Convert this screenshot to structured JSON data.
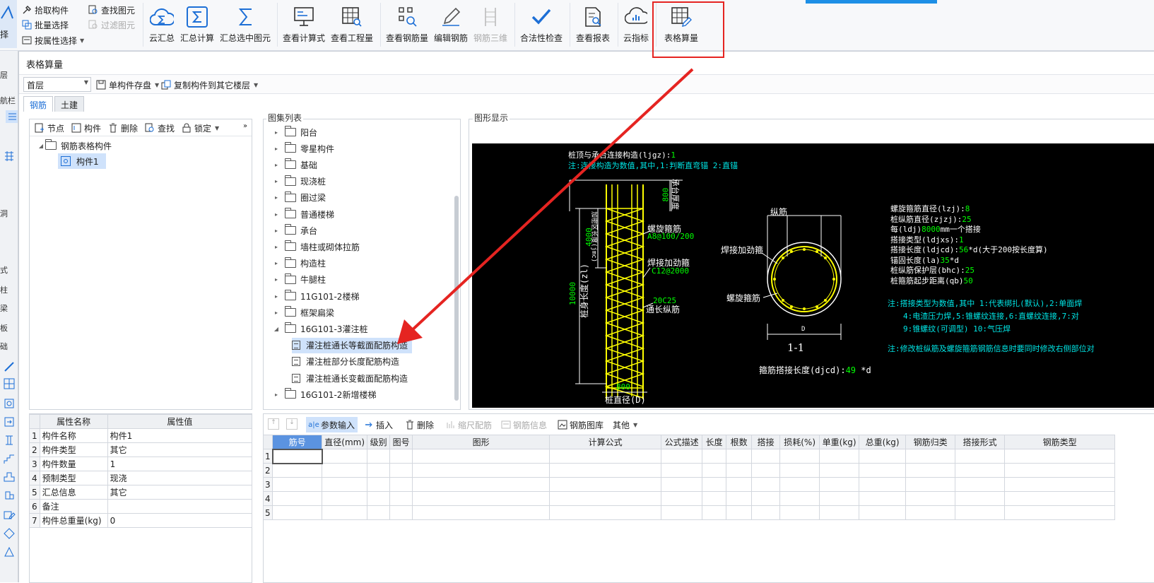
{
  "ribbon": {
    "left_partial": "选择",
    "small_col1": [
      "拾取构件",
      "批量选择",
      "按属性选择"
    ],
    "small_col2": [
      "查找图元",
      "过滤图元"
    ],
    "buttons": [
      {
        "label": "云汇总",
        "icon": "cloud-sigma-icon"
      },
      {
        "label": "汇总计算",
        "icon": "sigma-icon"
      },
      {
        "label": "汇总选中图元",
        "icon": "sigma-select-icon"
      },
      {
        "label": "查看计算式",
        "icon": "formula-view-icon"
      },
      {
        "label": "查看工程量",
        "icon": "quantity-view-icon"
      },
      {
        "label": "查看钢筋量",
        "icon": "rebar-view-icon"
      },
      {
        "label": "编辑钢筋",
        "icon": "pencil-icon"
      },
      {
        "label": "钢筋三维",
        "icon": "rebar-3d-icon",
        "disabled": true
      },
      {
        "label": "合法性检查",
        "icon": "check-icon"
      },
      {
        "label": "查看报表",
        "icon": "report-icon"
      },
      {
        "label": "云指标",
        "icon": "cloud-chart-icon"
      },
      {
        "label": "表格算量",
        "icon": "table-edit-icon"
      }
    ],
    "highlight_color": "#e52421",
    "accent_color": "#1d6fd6"
  },
  "leftstrip": [
    "层",
    "航栏",
    "",
    "洞",
    "式",
    "柱",
    "梁",
    "板",
    "础"
  ],
  "dialog": {
    "title": "表格算量",
    "floor_combo": "首层",
    "toolbar": [
      "单构件存盘",
      "复制构件到其它楼层"
    ],
    "tabs": [
      "钢筋",
      "土建"
    ],
    "tree_toolbar": [
      "节点",
      "构件",
      "删除",
      "查找",
      "锁定"
    ],
    "tree": {
      "root": "钢筋表格构件",
      "child": "构件1"
    },
    "atlas_label": "图集列表",
    "atlas": [
      {
        "label": "阳台",
        "type": "folder"
      },
      {
        "label": "零星构件",
        "type": "folder"
      },
      {
        "label": "基础",
        "type": "folder"
      },
      {
        "label": "现浇桩",
        "type": "folder"
      },
      {
        "label": "圈过梁",
        "type": "folder"
      },
      {
        "label": "普通楼梯",
        "type": "folder"
      },
      {
        "label": "承台",
        "type": "folder"
      },
      {
        "label": "墙柱或砌体拉筋",
        "type": "folder"
      },
      {
        "label": "构造柱",
        "type": "folder"
      },
      {
        "label": "牛腿柱",
        "type": "folder"
      },
      {
        "label": "11G101-2楼梯",
        "type": "folder"
      },
      {
        "label": "框架扁梁",
        "type": "folder"
      },
      {
        "label": "16G101-3灌注桩",
        "type": "folder-open"
      },
      {
        "label": "灌注桩通长等截面配筋构造",
        "type": "doc",
        "selected": true
      },
      {
        "label": "灌注桩部分长度配筋构造",
        "type": "doc"
      },
      {
        "label": "灌注桩通长变截面配筋构造",
        "type": "doc"
      },
      {
        "label": "16G101-2新增楼梯",
        "type": "folder"
      }
    ],
    "figure_label": "图形显示",
    "props": {
      "headers": [
        "属性名称",
        "属性值"
      ],
      "rows": [
        [
          "1",
          "构件名称",
          "构件1"
        ],
        [
          "2",
          "构件类型",
          "其它"
        ],
        [
          "3",
          "构件数量",
          "1"
        ],
        [
          "4",
          "预制类型",
          "现浇"
        ],
        [
          "5",
          "汇总信息",
          "其它"
        ],
        [
          "6",
          "备注",
          ""
        ],
        [
          "7",
          "构件总重量(kg)",
          "0"
        ]
      ]
    },
    "grid_toolbar": [
      {
        "label": "参数输入",
        "active": true
      },
      {
        "label": "插入"
      },
      {
        "label": "删除"
      },
      {
        "label": "缩尺配筋",
        "disabled": true
      },
      {
        "label": "钢筋信息",
        "disabled": true
      },
      {
        "label": "钢筋图库"
      },
      {
        "label": "其他"
      }
    ],
    "grid": {
      "headers": [
        "筋号",
        "直径(mm)",
        "级别",
        "图号",
        "图形",
        "计算公式",
        "公式描述",
        "长度",
        "根数",
        "搭接",
        "损耗(%)",
        "单重(kg)",
        "总重(kg)",
        "钢筋归类",
        "搭接形式",
        "钢筋类型"
      ],
      "rows": [
        "1",
        "2",
        "3",
        "4",
        "5"
      ]
    }
  },
  "cad": {
    "line1": "桩顶与承台连接构造(ljgz):",
    "line1_val": "1",
    "line2": "注:连接构造为数值,其中,1:判断直弯锚    2:直锚",
    "v800": "800",
    "chengtai": "承台厚度",
    "v4000": "4000",
    "jiaqiang": "加密区长度(jmc)",
    "v10000": "10000",
    "zhuchang": "桩身长度(zl)",
    "luoxuan": "螺旋箍筋",
    "luoxuan_val": "A8@100/200",
    "hanjie": "焊接加劲箍",
    "hanjie_val": "C12@2000",
    "zongjin_val": "20C25",
    "tongchang": "通长纵筋",
    "bottom800": "800",
    "zhijing": "桩直径(D)",
    "zongjin": "纵筋",
    "hanjie2": "焊接加劲箍",
    "luoxuan2": "螺旋箍筋",
    "dlabel": "D",
    "section": "1-1",
    "djcd": "箍筋搭接长度(djcd):",
    "djcd_val": "49",
    "djcd_unit": "*d",
    "params": [
      {
        "label": "螺旋箍筋直径(lzj):",
        "val": "8"
      },
      {
        "label": "桩纵筋直径(zjzj):",
        "val": "25"
      },
      {
        "label": "每(ldj)",
        "val": "8000",
        "suffix": "mm一个搭接"
      },
      {
        "label": "搭接类型(ldjxs):",
        "val": "1"
      },
      {
        "label": "搭接长度(ldjcd):",
        "val": "56",
        "suffix": "*d(大于200按长度算)"
      },
      {
        "label": "锚固长度(la)",
        "val": "35",
        "suffix": "*d"
      },
      {
        "label": "桩纵筋保护层(bhc):",
        "val": "25"
      },
      {
        "label": "桩箍筋起步距离(qb)",
        "val": "50"
      }
    ],
    "note1": "注:搭接类型为数值,其中 1:代表绑扎(默认),2:单面焊",
    "note2": "4:电渣压力焊,5:锥螺纹连接,6:直螺纹连接,7:对",
    "note3": "9:锥螺纹(可调型) 10:气压焊",
    "note4": "注:修改桩纵筋及螺旋箍筋钢筋信息时要同时修改右侧部位对"
  }
}
